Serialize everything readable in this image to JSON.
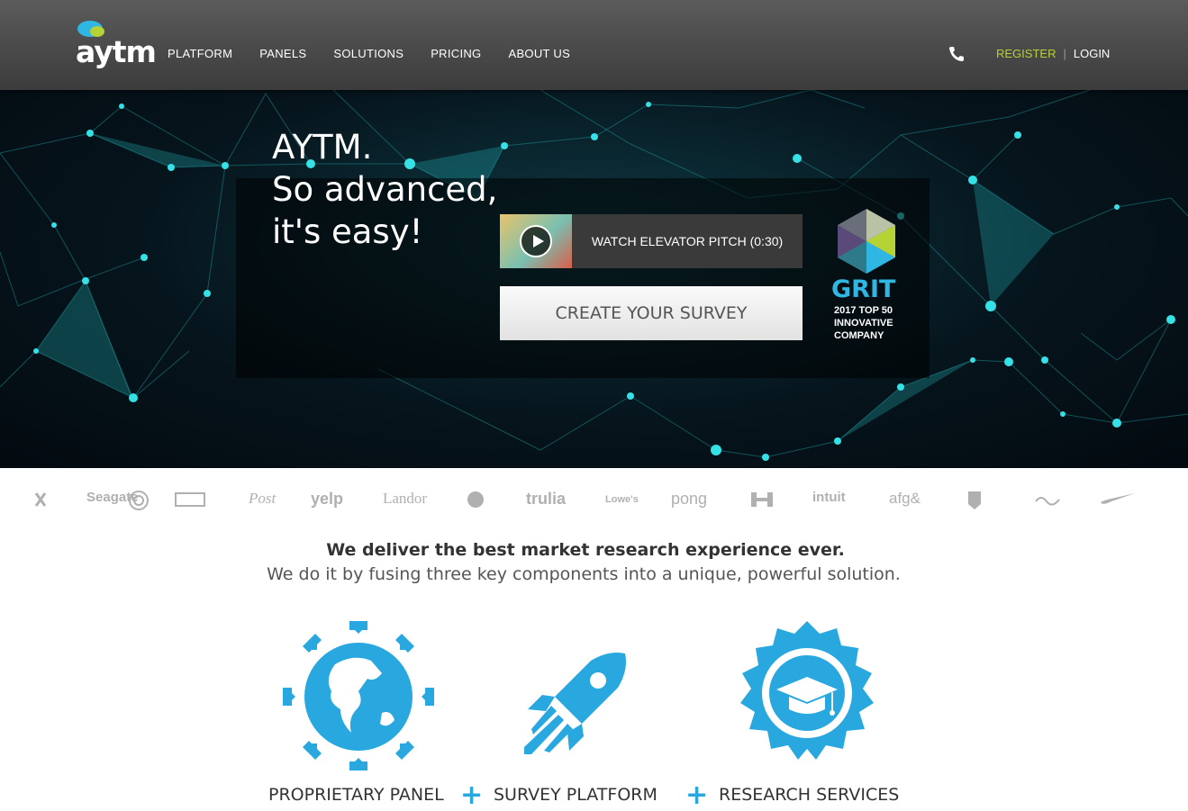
{
  "header": {
    "logo_text": "aytm",
    "nav": [
      "PLATFORM",
      "PANELS",
      "SOLUTIONS",
      "PRICING",
      "ABOUT US"
    ],
    "register": "REGISTER",
    "separator": "|",
    "login": "LOGIN"
  },
  "hero": {
    "title_lines": [
      "AYTM.",
      "So advanced,",
      "it's easy!"
    ],
    "pitch_label": "WATCH ELEVATOR PITCH (0:30)",
    "create_label": "CREATE YOUR SURVEY",
    "grit_title": "GRIT",
    "grit_lines": [
      "2017 TOP 50",
      "INNOVATIVE",
      "COMPANY"
    ]
  },
  "client_logos": [
    "Seagate",
    "Post",
    "yelp",
    "Landor",
    "trulia",
    "pong",
    "intuit",
    "afg&",
    "Lowe's",
    "nike"
  ],
  "tagline": {
    "headline": "We deliver the best market research experience ever.",
    "sub": "We do it by fusing three key components into a unique, powerful solution."
  },
  "components": [
    {
      "label": "PROPRIETARY PANEL",
      "icon": "globe-icon"
    },
    {
      "label": "SURVEY PLATFORM",
      "icon": "rocket-icon"
    },
    {
      "label": "RESEARCH SERVICES",
      "icon": "graduation-badge-icon"
    }
  ],
  "plus_sign": "+",
  "colors": {
    "accent": "#29a8e0",
    "register": "#b5d334",
    "header_bg": "#4a4a4a"
  }
}
